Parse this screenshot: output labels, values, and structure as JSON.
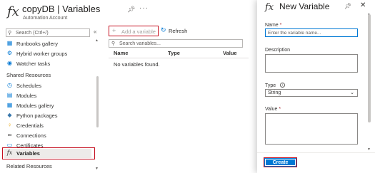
{
  "header": {
    "title": "copyDB | Variables",
    "subtitle": "Automation Account"
  },
  "sidebar": {
    "search_placeholder": "Search (Ctrl+/)",
    "collapse": "«",
    "items_top": [
      {
        "label": "Runbooks gallery",
        "icon": "gallery-icon"
      },
      {
        "label": "Hybrid worker groups",
        "icon": "worker-groups-icon"
      },
      {
        "label": "Watcher tasks",
        "icon": "watcher-icon"
      }
    ],
    "shared_resources_heading": "Shared Resources",
    "shared_items": [
      {
        "label": "Schedules",
        "icon": "schedule-icon"
      },
      {
        "label": "Modules",
        "icon": "modules-icon"
      },
      {
        "label": "Modules gallery",
        "icon": "modules-gallery-icon"
      },
      {
        "label": "Python packages",
        "icon": "python-icon"
      },
      {
        "label": "Credentials",
        "icon": "key-icon"
      },
      {
        "label": "Connections",
        "icon": "connection-icon"
      },
      {
        "label": "Certificates",
        "icon": "certificate-icon"
      },
      {
        "label": "Variables",
        "icon": "fx-icon"
      }
    ],
    "related_resources_heading": "Related Resources"
  },
  "toolbar": {
    "add_label": "Add a variable",
    "refresh_label": "Refresh"
  },
  "main": {
    "search_placeholder": "Search variables...",
    "columns": [
      "Name",
      "Type",
      "Value"
    ],
    "empty_message": "No variables found."
  },
  "panel": {
    "title": "New Variable",
    "name_label": "Name",
    "name_placeholder": "Enter the variable name...",
    "description_label": "Description",
    "type_label": "Type",
    "type_value": "String",
    "value_label": "Value",
    "required_marker": "*",
    "create_label": "Create"
  },
  "colors": {
    "accent": "#0078d4",
    "highlight": "#c50f1f"
  }
}
